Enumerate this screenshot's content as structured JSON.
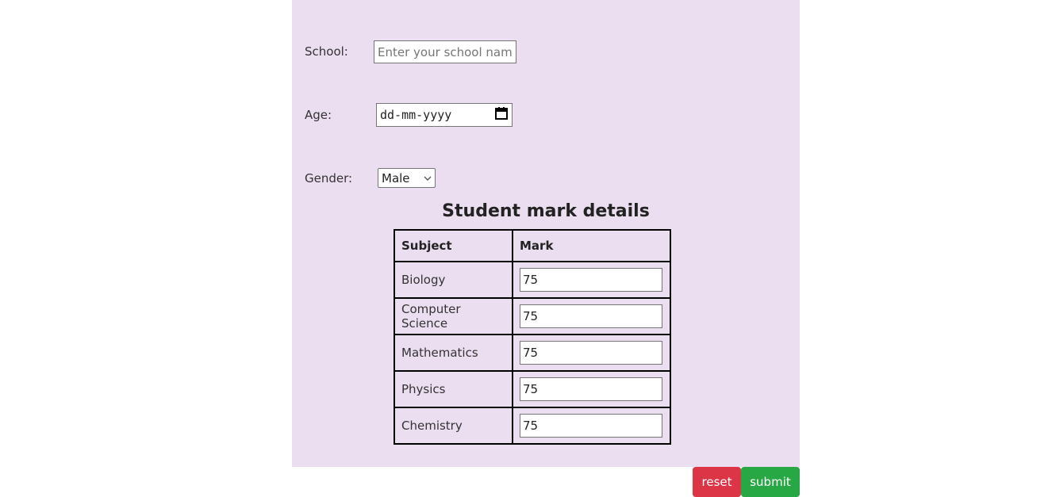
{
  "form": {
    "school_label": "School:",
    "school_placeholder": "Enter your school name",
    "age_label": "Age:",
    "age_placeholder": "dd-mm-yyyy",
    "gender_label": "Gender:",
    "gender_selected": "Male"
  },
  "marks_table": {
    "title": "Student mark details",
    "headers": [
      "Subject",
      "Mark"
    ],
    "rows": [
      {
        "subject": "Biology",
        "mark": "75"
      },
      {
        "subject": "Computer Science",
        "mark": "75"
      },
      {
        "subject": "Mathematics",
        "mark": "75"
      },
      {
        "subject": "Physics",
        "mark": "75"
      },
      {
        "subject": "Chemistry",
        "mark": "75"
      }
    ]
  },
  "actions": {
    "reset_label": "reset",
    "submit_label": "submit"
  },
  "colors": {
    "panel_bg": "#ebdef0",
    "reset_bg": "#dc3545",
    "submit_bg": "#28a745"
  }
}
